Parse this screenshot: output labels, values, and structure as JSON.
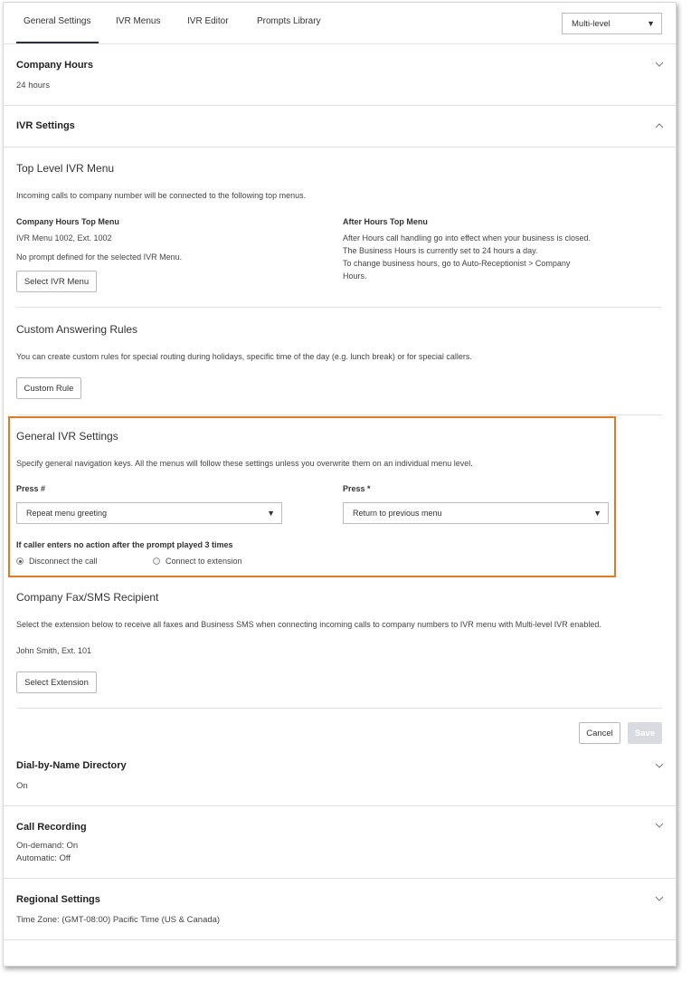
{
  "tabs": [
    "General Settings",
    "IVR Menus",
    "IVR Editor",
    "Prompts Library"
  ],
  "mode_select": "Multi-level",
  "company_hours": {
    "title": "Company Hours",
    "value": "24 hours"
  },
  "ivr_settings": {
    "title": "IVR Settings"
  },
  "top_level": {
    "heading": "Top Level IVR Menu",
    "description": "Incoming calls to company number will be connected to the following top menus.",
    "company_hours_label": "Company Hours Top Menu",
    "company_hours_menu": "IVR Menu 1002, Ext. 1002",
    "no_prompt": "No prompt defined for the selected IVR Menu.",
    "select_button": "Select IVR Menu",
    "after_hours_label": "After Hours Top Menu",
    "after_hours_lines": [
      "After Hours call handling go into effect when your business is closed.",
      "The Business Hours is currently set to 24 hours a day.",
      "To change business hours, go to Auto-Receptionist > Company",
      "Hours."
    ]
  },
  "custom_rules": {
    "heading": "Custom Answering Rules",
    "description": "You can create custom rules for special routing during holidays, specific time of the day (e.g. lunch break) or for special callers.",
    "button": "Custom Rule"
  },
  "general_ivr": {
    "heading": "General IVR Settings",
    "description": "Specify general navigation keys. All the menus will follow these settings unless you overwrite them on an individual menu level.",
    "press_hash_label": "Press #",
    "press_hash_value": "Repeat menu greeting",
    "press_star_label": "Press *",
    "press_star_value": "Return to previous menu",
    "no_action_label": "If caller enters no action after the prompt played 3 times",
    "option_disconnect": "Disconnect the call",
    "option_connect": "Connect to extension"
  },
  "fax": {
    "heading": "Company Fax/SMS Recipient",
    "description": "Select the extension below to receive all faxes and Business SMS when connecting incoming calls to company numbers to IVR menu with Multi-level IVR enabled.",
    "recipient": "John Smith, Ext. 101",
    "button": "Select Extension"
  },
  "actions": {
    "cancel": "Cancel",
    "save": "Save"
  },
  "dial_by_name": {
    "title": "Dial-by-Name Directory",
    "value": "On"
  },
  "call_recording": {
    "title": "Call Recording",
    "line1": "On-demand: On",
    "line2": "Automatic: Off"
  },
  "regional": {
    "title": "Regional Settings",
    "value": "Time Zone: (GMT-08:00) Pacific Time (US & Canada)"
  }
}
